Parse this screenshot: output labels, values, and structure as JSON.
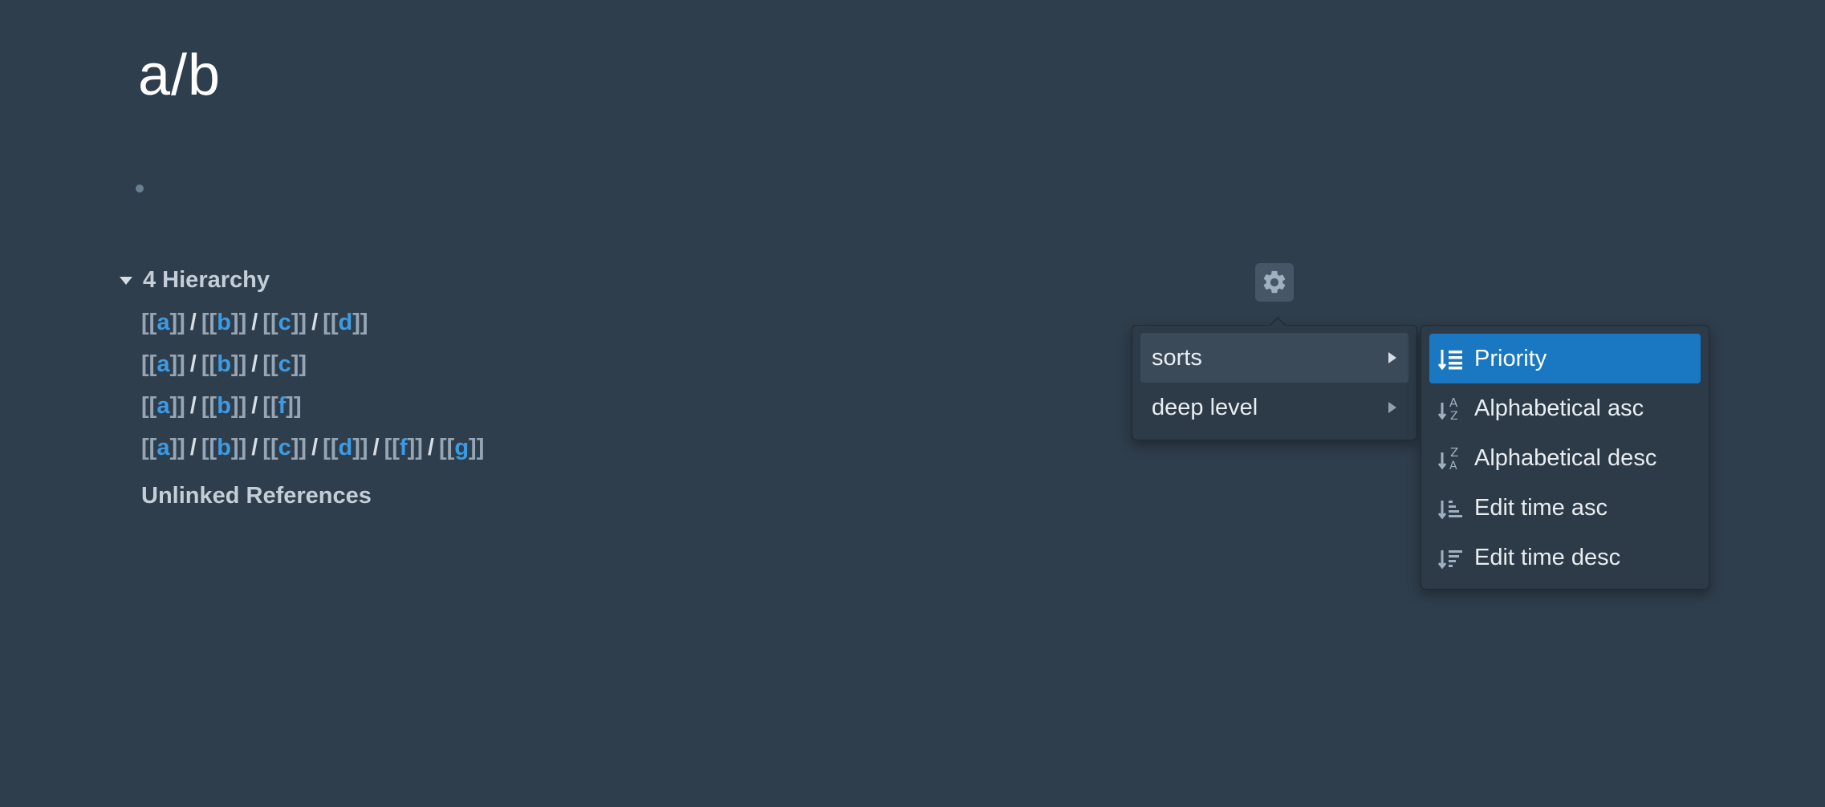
{
  "page": {
    "title": "a/b"
  },
  "hierarchy": {
    "header": "4 Hierarchy",
    "rows": [
      [
        "a",
        "b",
        "c",
        "d"
      ],
      [
        "a",
        "b",
        "c"
      ],
      [
        "a",
        "b",
        "f"
      ],
      [
        "a",
        "b",
        "c",
        "d",
        "f",
        "g"
      ]
    ]
  },
  "unlinked_references": "Unlinked References",
  "settings_menu": {
    "items": [
      {
        "label": "sorts"
      },
      {
        "label": "deep level"
      }
    ]
  },
  "sorts_submenu": {
    "items": [
      {
        "label": "Priority",
        "icon": "sort-priority-icon",
        "selected": true
      },
      {
        "label": "Alphabetical asc",
        "icon": "sort-alpha-asc-icon"
      },
      {
        "label": "Alphabetical desc",
        "icon": "sort-alpha-desc-icon"
      },
      {
        "label": "Edit time asc",
        "icon": "sort-time-asc-icon"
      },
      {
        "label": "Edit time desc",
        "icon": "sort-time-desc-icon"
      }
    ]
  },
  "colors": {
    "background": "#2f3e4c",
    "link": "#3d9be3",
    "selected": "#1a78c2"
  }
}
